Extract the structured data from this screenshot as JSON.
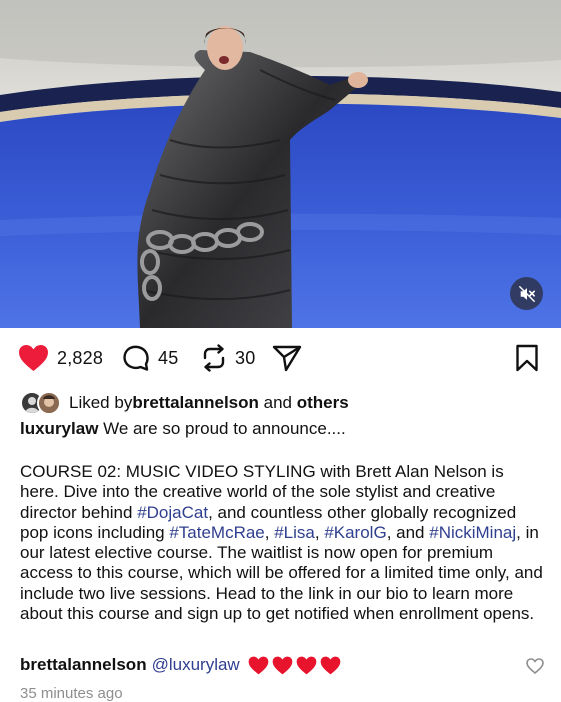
{
  "media": {
    "image_description_icon": "video-frame",
    "mute_icon": "speaker-muted-icon"
  },
  "actions": {
    "like_count": "2,828",
    "comment_count": "45",
    "repost_count": "30",
    "like_color": "#ed1c3b"
  },
  "likes": {
    "prefix": "Liked by ",
    "user": "brettalannelson",
    "conjunction": " and ",
    "others": "others"
  },
  "caption": {
    "username": "luxurylaw",
    "headline": " We are so proud to announce....",
    "body_parts": [
      {
        "text": "COURSE 02: MUSIC VIDEO STYLING with Brett Alan Nelson is here. Dive into the creative world of the sole stylist and creative director behind ",
        "tag": false
      },
      {
        "text": "#DojaCat",
        "tag": true
      },
      {
        "text": ", and countless other globally recognized pop icons including ",
        "tag": false
      },
      {
        "text": "#TateMcRae",
        "tag": true
      },
      {
        "text": ", ",
        "tag": false
      },
      {
        "text": "#Lisa",
        "tag": true
      },
      {
        "text": ", ",
        "tag": false
      },
      {
        "text": "#KarolG",
        "tag": true
      },
      {
        "text": ", and ",
        "tag": false
      },
      {
        "text": "#NickiMinaj",
        "tag": true
      },
      {
        "text": ", in our latest elective course. The waitlist is now open for premium access to this course, which will be offered for a limited time only, and include two live sessions. Head to the link in our bio to learn more about this course and sign up to get notified when enrollment opens.",
        "tag": false
      }
    ]
  },
  "comment": {
    "username": "brettalannelson",
    "mention": "@luxurylaw",
    "hearts": [
      "❤️",
      "❤️",
      "❤️",
      "❤️"
    ]
  },
  "timestamp": "35 minutes ago",
  "colors": {
    "hashtag": "#2f3f8f",
    "muted_text": "#8e8e8e"
  }
}
